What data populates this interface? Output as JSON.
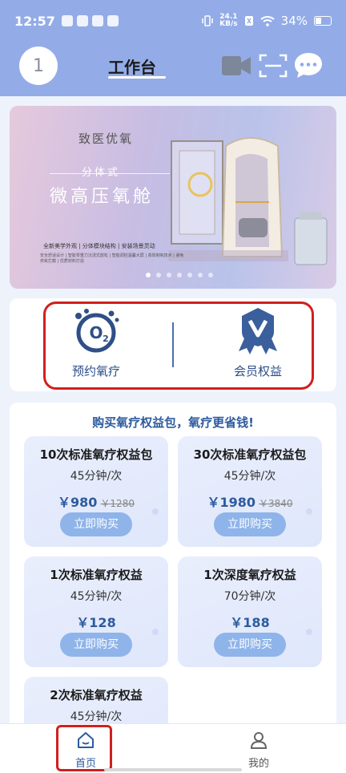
{
  "status": {
    "time": "12:57",
    "net_speed_top": "24.1",
    "net_speed_bottom": "KB/s",
    "battery": "34%"
  },
  "header": {
    "avatar_text": "1",
    "title": "工作台"
  },
  "banner": {
    "brand": "致医优氧",
    "subtitle": "分体式",
    "headline": "微高压氧舱",
    "features": "全新美学外观 | 分体模块结构 | 安装场景灵动",
    "features_small": "安全舒适设计 | 智能零重力沉浸式放松 | 智能调控温馨大屏 | 高效制氧技术 | 避免供氧拦截 | 优质材料打造",
    "dots_count": 7,
    "active_dot": 0
  },
  "services": [
    {
      "label": "预约氧疗",
      "icon": "o2-icon"
    },
    {
      "label": "会员权益",
      "icon": "member-badge-icon"
    }
  ],
  "promo": {
    "title": "购买氧疗权益包，氧疗更省钱!"
  },
  "packages": [
    {
      "title": "10次标准氧疗权益包",
      "duration": "45分钟/次",
      "price": "￥980",
      "old_price": "￥1280",
      "button": "立即购买"
    },
    {
      "title": "30次标准氧疗权益包",
      "duration": "45分钟/次",
      "price": "￥1980",
      "old_price": "￥3840",
      "button": "立即购买"
    },
    {
      "title": "1次标准氧疗权益",
      "duration": "45分钟/次",
      "price": "￥128",
      "old_price": "",
      "button": "立即购买"
    },
    {
      "title": "1次深度氧疗权益",
      "duration": "70分钟/次",
      "price": "￥188",
      "old_price": "",
      "button": "立即购买"
    },
    {
      "title": "2次标准氧疗权益",
      "duration": "45分钟/次",
      "price": "",
      "old_price": "",
      "button": ""
    }
  ],
  "tabbar": {
    "home": "首页",
    "mine": "我的"
  },
  "colors": {
    "header_bg": "#93ace8",
    "accent": "#2d5b9e",
    "highlight": "#d0201f"
  }
}
